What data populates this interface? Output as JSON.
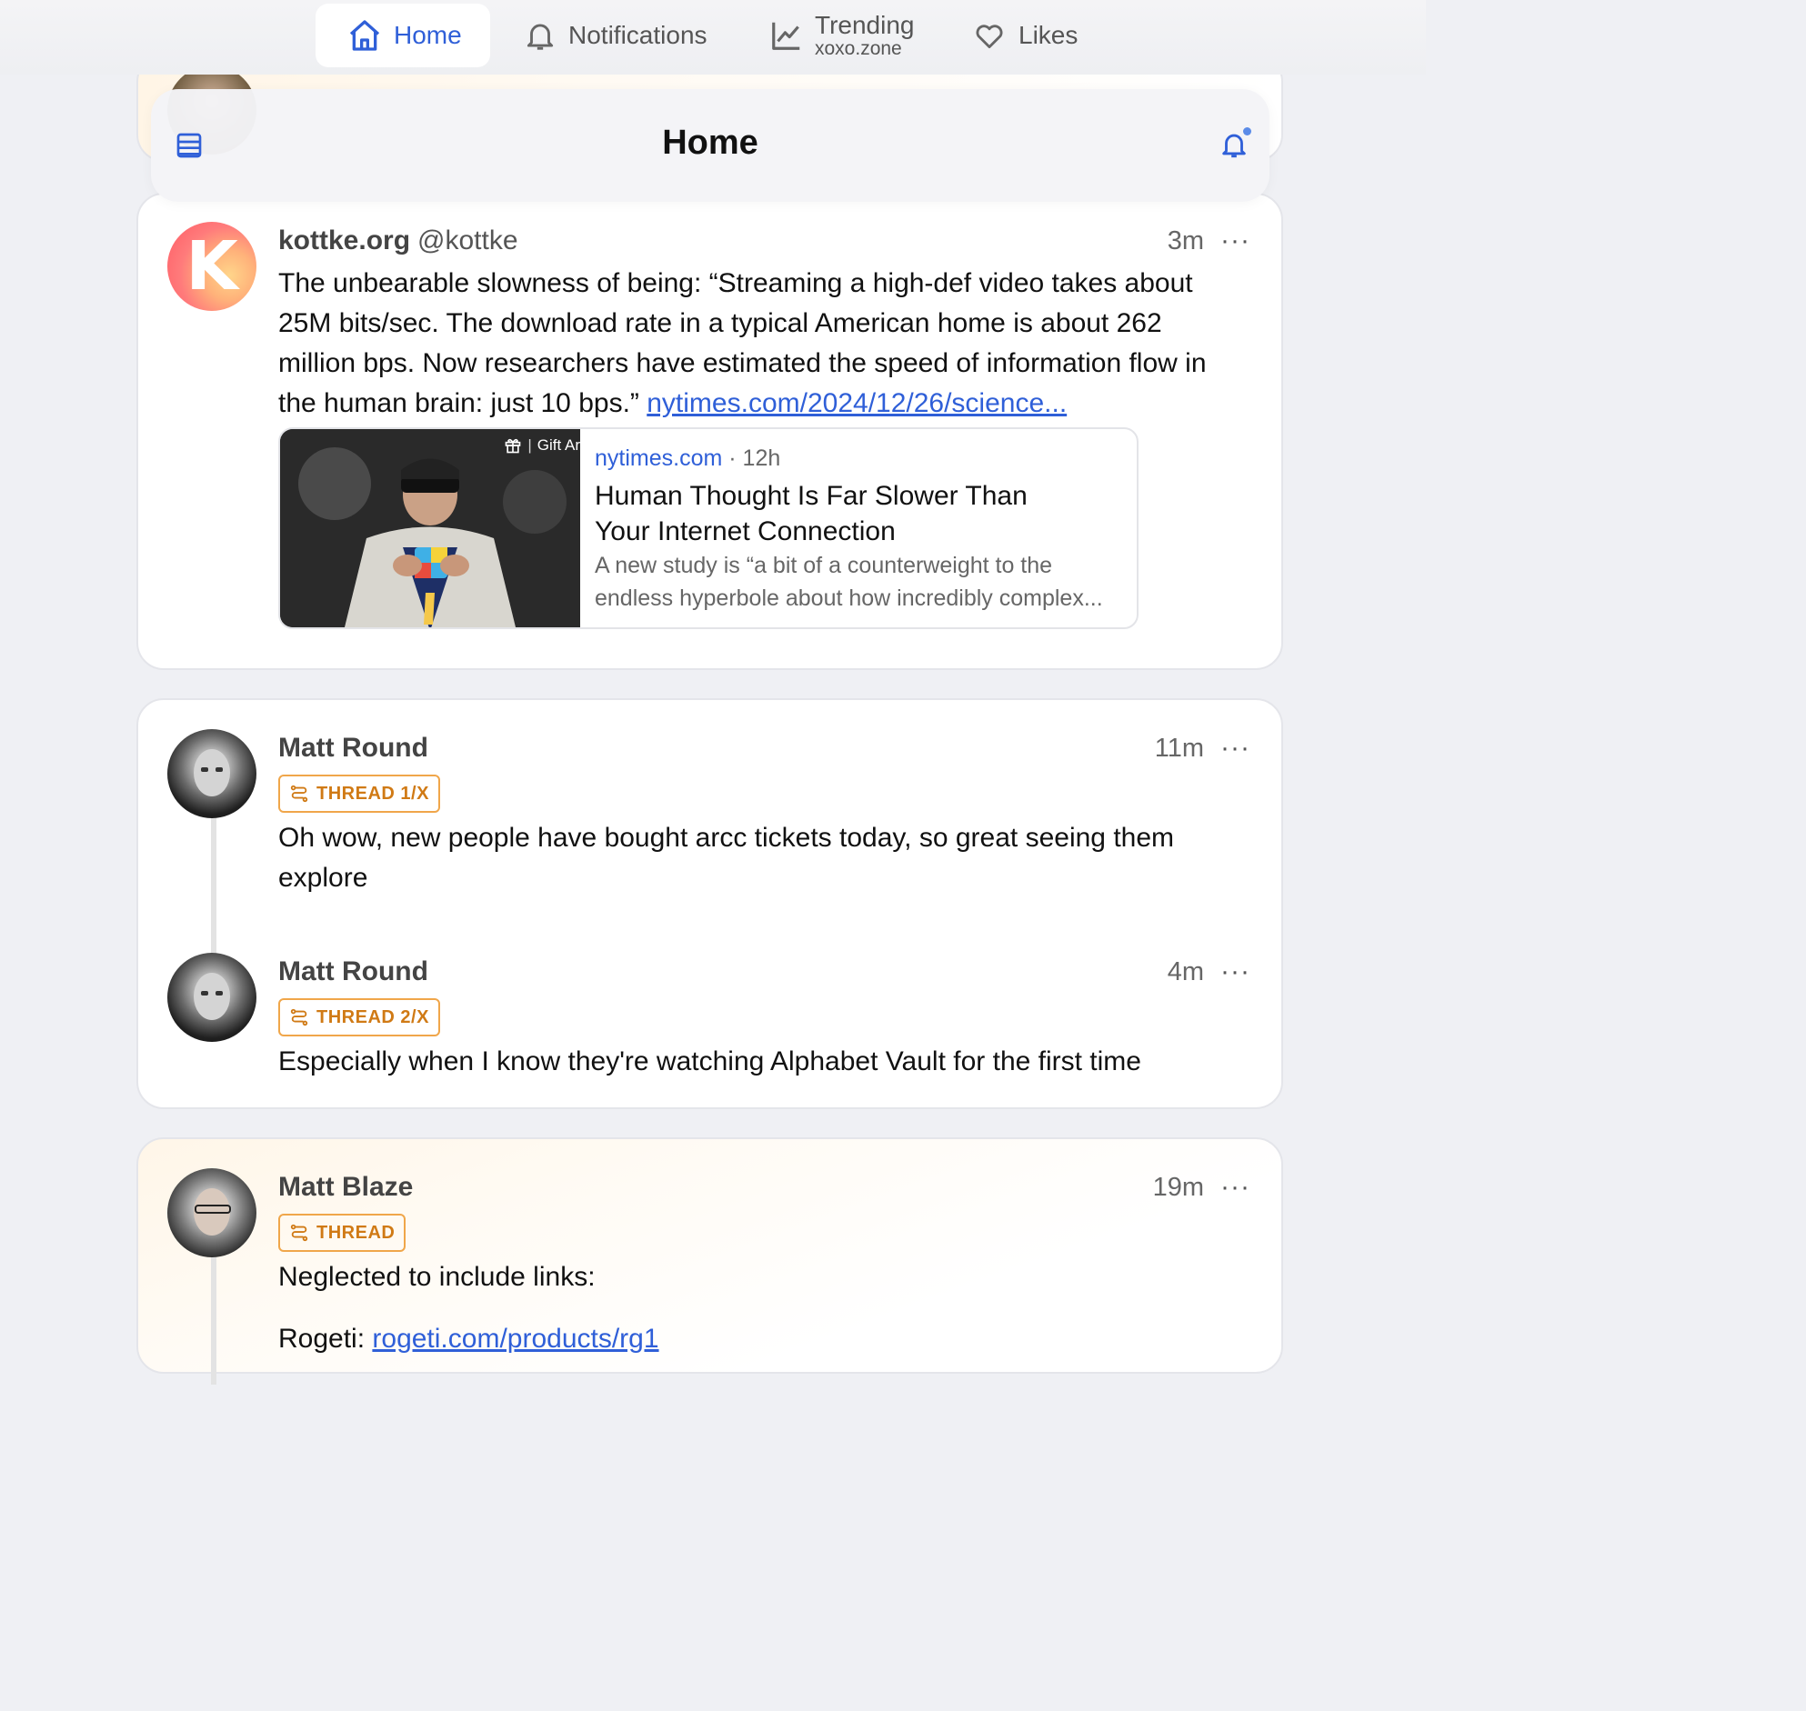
{
  "nav": {
    "home": "Home",
    "notifications": "Notifications",
    "trending": "Trending",
    "trending_sub": "xoxo.zone",
    "likes": "Likes"
  },
  "header": {
    "title": "Home"
  },
  "posts": [
    {
      "name": "kottke.org",
      "handle": "@kottke",
      "time": "3m",
      "avatar_letter": "K",
      "text": "The unbearable slowness of being: “Streaming a high-def video takes about 25M bits/sec. The download rate in a typical American home is about 262 million bps. Now researchers have estimated the speed of information flow in the human brain: just 10 bps.”",
      "link": "nytimes.com/2024/12/26/science...",
      "preview": {
        "badge": "Gift Ar",
        "domain": "nytimes.com",
        "age": "· 12h",
        "title": "Human Thought Is Far Slower Than Your Internet Connection",
        "desc": "A new study is “a bit of a counterweight to the endless hyperbole about how incredibly complex..."
      }
    },
    {
      "name": "Matt Round",
      "time": "11m",
      "badge": "THREAD 1/X",
      "text": "Oh wow, new people have bought arcc tickets today, so great seeing them explore"
    },
    {
      "name": "Matt Round",
      "time": "4m",
      "badge": "THREAD 2/X",
      "text": "Especially when I know they're watching Alphabet Vault for the first time"
    },
    {
      "name": "Matt Blaze",
      "time": "19m",
      "badge": "THREAD",
      "text": "Neglected to include links:",
      "link_label": "Rogeti: ",
      "link": "rogeti.com/products/rg1"
    }
  ],
  "more_label": "···",
  "colors": {
    "accent": "#2f5fd8",
    "thread_badge": "#d07a15"
  }
}
